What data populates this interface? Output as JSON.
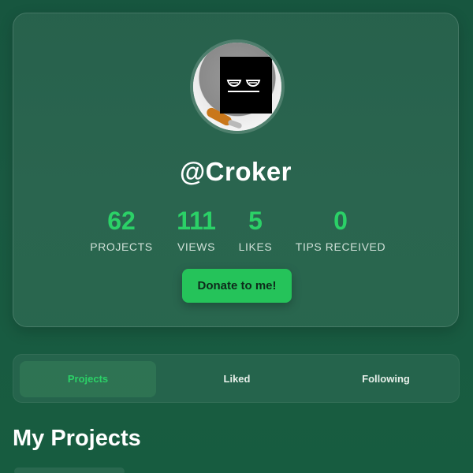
{
  "profile": {
    "username": "@Croker",
    "stats": [
      {
        "value": "62",
        "label": "PROJECTS"
      },
      {
        "value": "111",
        "label": "VIEWS"
      },
      {
        "value": "5",
        "label": "LIKES"
      },
      {
        "value": "0",
        "label": "TIPS RECEIVED"
      }
    ],
    "donate_label": "Donate to me!"
  },
  "tabs": [
    {
      "label": "Projects",
      "active": true
    },
    {
      "label": "Liked",
      "active": false
    },
    {
      "label": "Following",
      "active": false
    }
  ],
  "section": {
    "title": "My Projects"
  },
  "colors": {
    "accent": "#2bd167",
    "button": "#25c35a",
    "background": "#1a5a42"
  }
}
